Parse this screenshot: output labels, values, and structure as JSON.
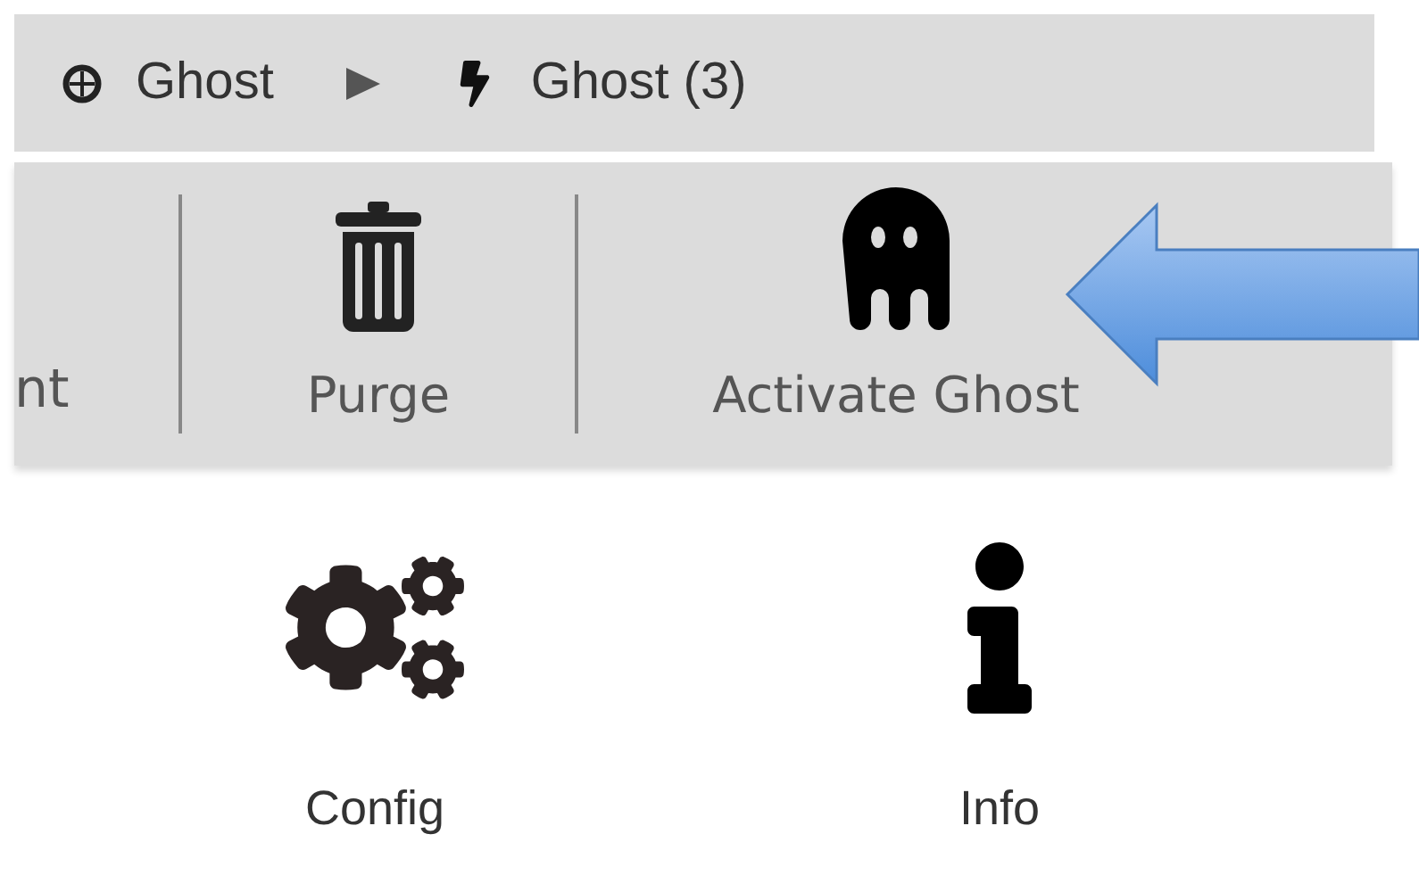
{
  "breadcrumb": [
    {
      "kind": "target",
      "label": "Ghost"
    },
    {
      "kind": "bolt",
      "label": "Ghost (3)"
    }
  ],
  "toolbar": [
    {
      "kind": "text",
      "label": "nt"
    },
    {
      "kind": "trash",
      "label": "Purge"
    },
    {
      "kind": "ghost",
      "label": "Activate Ghost"
    }
  ],
  "launcher": [
    {
      "kind": "gears",
      "label": "Config"
    },
    {
      "kind": "info",
      "label": "Info"
    }
  ]
}
